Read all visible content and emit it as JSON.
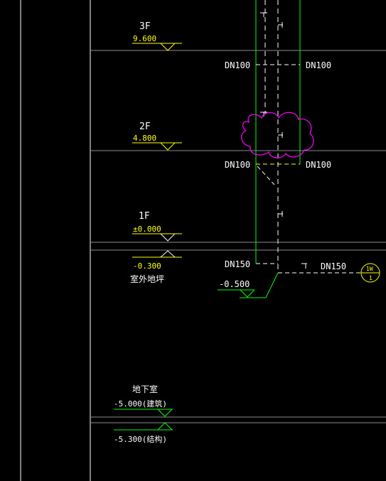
{
  "colors": {
    "background": "#000000",
    "frame_line": "#ffffff",
    "floor_line": "#8c8c8c",
    "floor_label": "#ffffff",
    "elevation": "#ffff00",
    "pipe_dashed": "#ffffff",
    "pipe_green": "#00ff00",
    "revision_cloud": "#ff00ff"
  },
  "floors": [
    {
      "name": "3F",
      "elevation": "9.600"
    },
    {
      "name": "2F",
      "elevation": "4.800"
    },
    {
      "name": "1F",
      "elevation": "±0.000",
      "sub_elevation": "-0.300",
      "sub_label": "室外地坪"
    }
  ],
  "basement": {
    "name": "地下室",
    "elevation_arch": "-5.000(建筑)",
    "elevation_struct": "-5.300(结构)"
  },
  "pipe_labels": {
    "upper_left": "DN100",
    "upper_right": "DN100",
    "mid_left": "DN100",
    "mid_right": "DN100",
    "bottom_left": "DN150",
    "outlet": "DN150",
    "invert_elevation": "-0.500"
  },
  "outlet_marker": {
    "code": "1W",
    "number": "1"
  }
}
